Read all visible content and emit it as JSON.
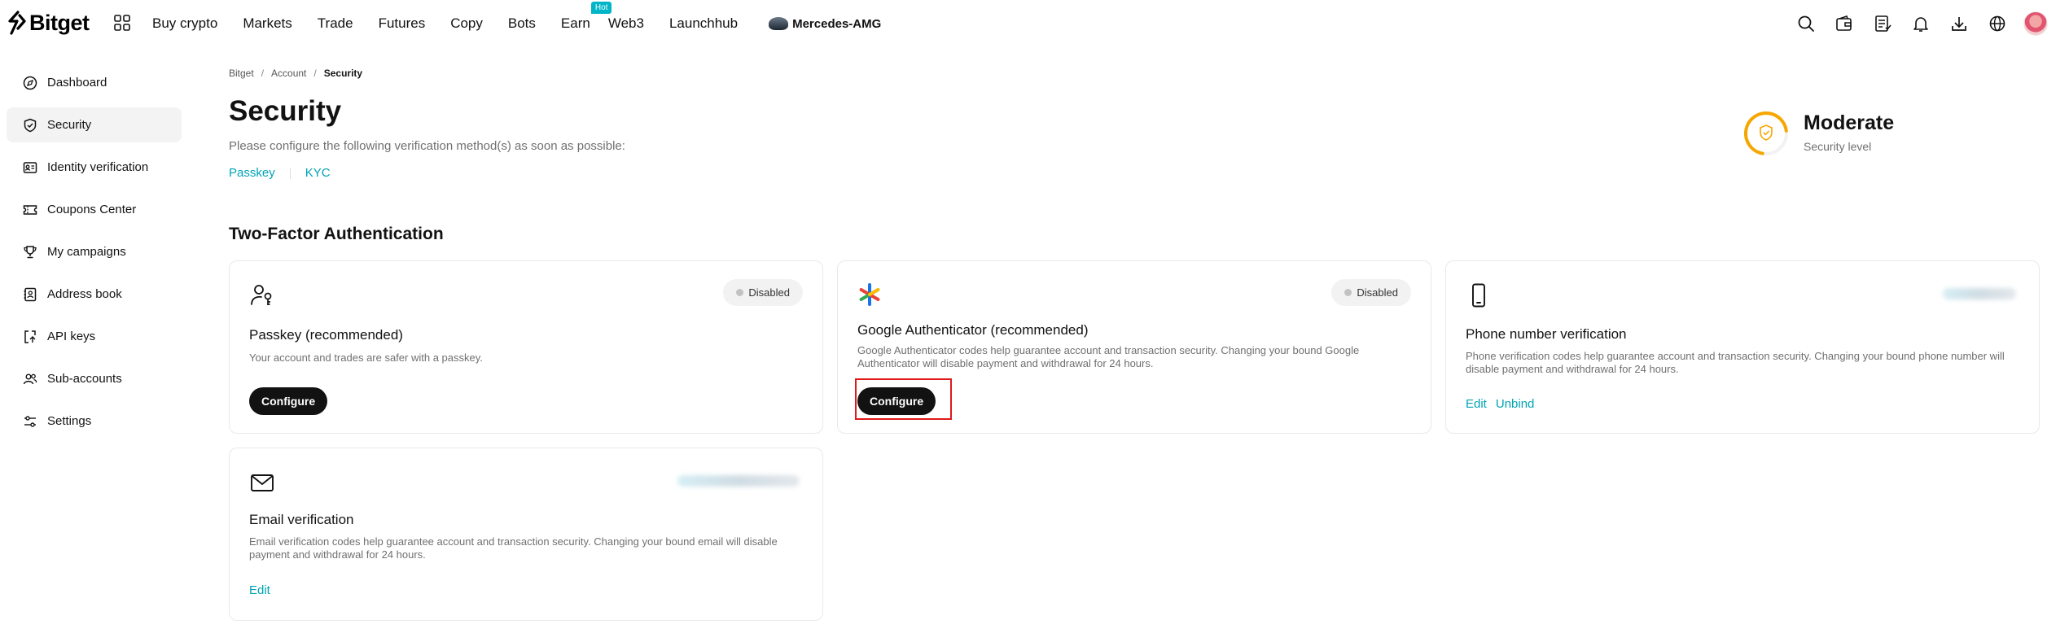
{
  "header": {
    "logo_text": "Bitget",
    "nav": [
      {
        "label": "Buy crypto"
      },
      {
        "label": "Markets"
      },
      {
        "label": "Trade"
      },
      {
        "label": "Futures"
      },
      {
        "label": "Copy"
      },
      {
        "label": "Bots"
      },
      {
        "label": "Earn",
        "badge": "Hot"
      },
      {
        "label": "Web3"
      },
      {
        "label": "Launchhub"
      }
    ],
    "brand_partner": "Mercedes-AMG",
    "icons": [
      "search-icon",
      "wallet-icon",
      "orders-icon",
      "bell-icon",
      "download-icon",
      "globe-icon",
      "avatar"
    ]
  },
  "sidebar": {
    "items": [
      {
        "label": "Dashboard",
        "icon": "compass-icon"
      },
      {
        "label": "Security",
        "icon": "shield-icon",
        "active": true
      },
      {
        "label": "Identity verification",
        "icon": "id-card-icon"
      },
      {
        "label": "Coupons Center",
        "icon": "ticket-icon"
      },
      {
        "label": "My campaigns",
        "icon": "trophy-icon"
      },
      {
        "label": "Address book",
        "icon": "address-book-icon"
      },
      {
        "label": "API keys",
        "icon": "api-icon"
      },
      {
        "label": "Sub-accounts",
        "icon": "users-icon"
      },
      {
        "label": "Settings",
        "icon": "sliders-icon"
      }
    ]
  },
  "breadcrumb": [
    "Bitget",
    "Account",
    "Security"
  ],
  "page": {
    "title": "Security",
    "subtitle": "Please configure the following verification method(s) as soon as possible:",
    "links": [
      "Passkey",
      "KYC"
    ]
  },
  "security_level": {
    "value": "Moderate",
    "label": "Security level",
    "accent": "#f7a600"
  },
  "section_title": "Two-Factor Authentication",
  "cards": {
    "passkey": {
      "title": "Passkey (recommended)",
      "desc": "Your account and trades are safer with a passkey.",
      "status": "Disabled",
      "button": "Configure"
    },
    "google": {
      "title": "Google Authenticator (recommended)",
      "desc": "Google Authenticator codes help guarantee account and transaction security. Changing your bound Google Authenticator will disable payment and withdrawal for 24 hours.",
      "status": "Disabled",
      "button": "Configure"
    },
    "phone": {
      "title": "Phone number verification",
      "desc": "Phone verification codes help guarantee account and transaction security. Changing your bound phone number will disable payment and withdrawal for 24 hours.",
      "links": [
        "Edit",
        "Unbind"
      ]
    },
    "email": {
      "title": "Email verification",
      "desc": "Email verification codes help guarantee account and transaction security. Changing your bound email will disable payment and withdrawal for 24 hours.",
      "links": [
        "Edit"
      ]
    }
  },
  "colors": {
    "link": "#00a3b4",
    "button": "#121212",
    "highlight": "#e01919"
  }
}
